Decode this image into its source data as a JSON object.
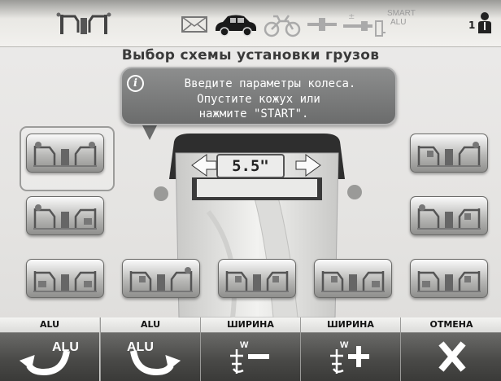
{
  "header": {
    "icons": [
      "wheel-scheme-icon",
      "mail-icon",
      "car-icon",
      "motorcycle-icon",
      "probe-icon",
      "calibration-icon",
      "smart-alu-icon",
      "operator-icon"
    ],
    "smart_alu_label_1": "SMART",
    "smart_alu_label_2": "ALU",
    "operator_number": "1"
  },
  "page_title": "Выбор схемы установки грузов",
  "message": {
    "line1": "Введите параметры колеса.",
    "line2": "Опустите кожух или",
    "line3": "нажмите \"START\"."
  },
  "wheel": {
    "width_value": "5.5\""
  },
  "schemes": {
    "selected_index": 0,
    "count": 9
  },
  "footer": {
    "buttons": [
      {
        "label": "ALU",
        "icon": "alu-rotate-left-icon",
        "icon_text": "ALU"
      },
      {
        "label": "ALU",
        "icon": "alu-rotate-right-icon",
        "icon_text": "ALU"
      },
      {
        "label": "ШИРИНА",
        "icon": "width-minus-icon",
        "icon_text": "W"
      },
      {
        "label": "ШИРИНА",
        "icon": "width-plus-icon",
        "icon_text": "W"
      },
      {
        "label": "ОТМЕНА",
        "icon": "cancel-icon"
      }
    ]
  },
  "colors": {
    "panel_bg": "#e4e3e1",
    "bubble_bg": "#7b7c7c",
    "button_face": "#4a4a48"
  }
}
